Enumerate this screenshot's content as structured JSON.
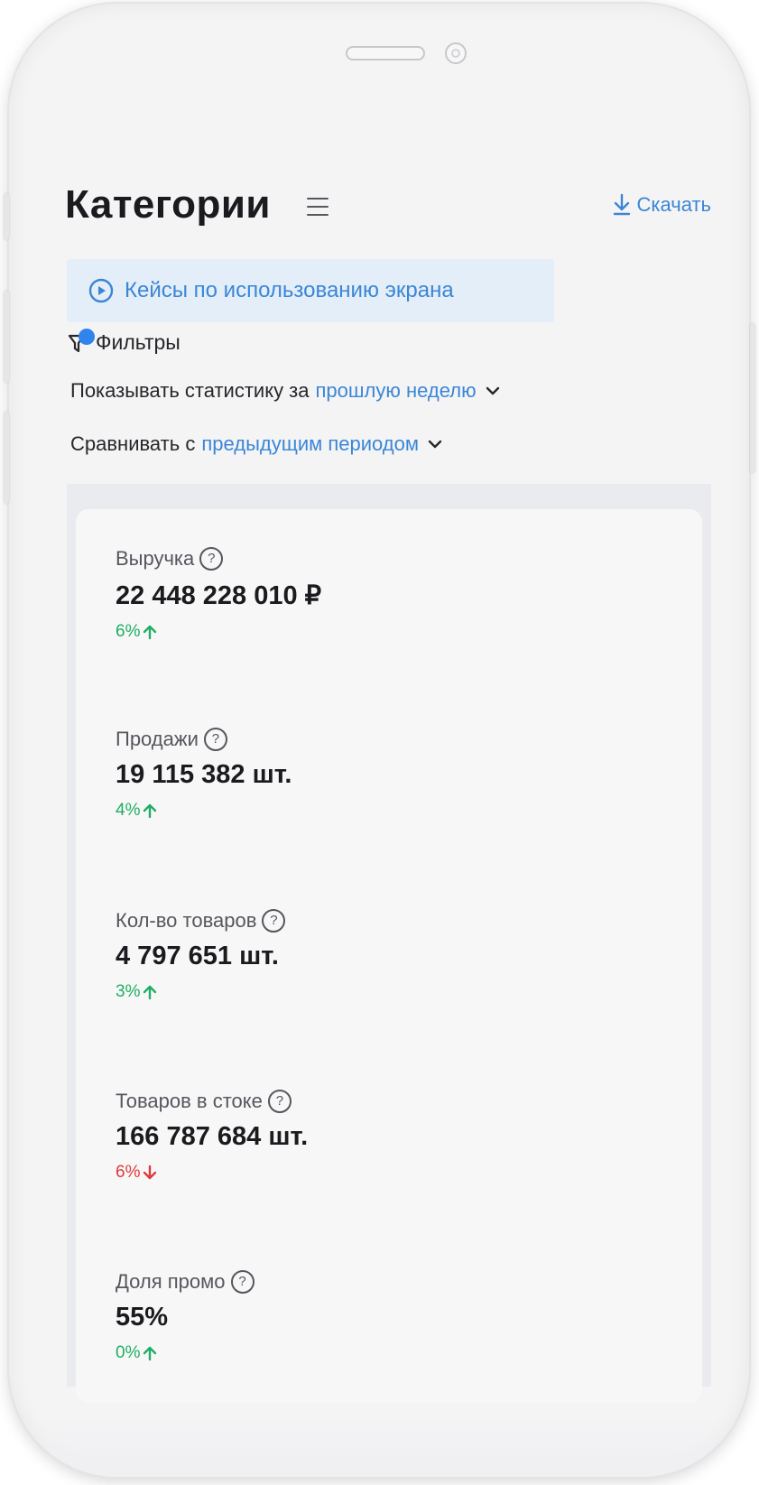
{
  "header": {
    "title": "Категории",
    "download_label": "Скачать"
  },
  "cases_button": {
    "label": "Кейсы по использованию экрана"
  },
  "filters": {
    "label": "Фильтры"
  },
  "period": {
    "prefix": "Показывать статистику за",
    "value": "прошлую неделю"
  },
  "compare": {
    "prefix": "Сравнивать с",
    "value": "предыдущим периодом"
  },
  "metrics": [
    {
      "label": "Выручка",
      "value": "22 448 228 010 ₽",
      "change": "6%",
      "direction": "up"
    },
    {
      "label": "Продажи",
      "value": "19 115 382 шт.",
      "change": "4%",
      "direction": "up"
    },
    {
      "label": "Кол-во товаров",
      "value": "4 797 651 шт.",
      "change": "3%",
      "direction": "up"
    },
    {
      "label": "Товаров в стоке",
      "value": "166 787 684 шт.",
      "change": "6%",
      "direction": "down"
    },
    {
      "label": "Доля промо",
      "value": "55%",
      "change": "0%",
      "direction": "up"
    }
  ],
  "help_glyph": "?",
  "colors": {
    "accent": "#3b86d6",
    "positive": "#1fae63",
    "negative": "#e0393b",
    "filter_dot": "#2f84ee"
  }
}
